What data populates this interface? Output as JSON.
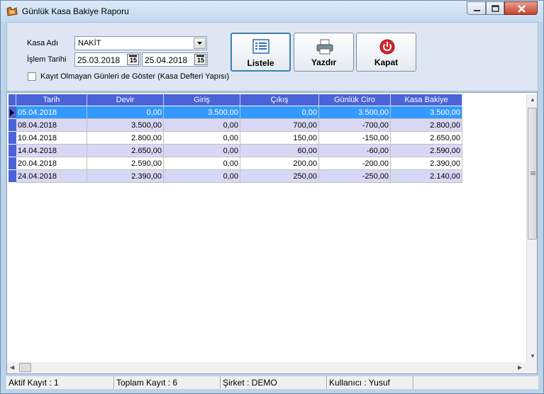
{
  "window": {
    "title": "Günlük Kasa Bakiye Raporu"
  },
  "filters": {
    "kasa_label": "Kasa Adı",
    "kasa_value": "NAKİT",
    "tarih_label": "İşlem Tarihi",
    "date_start": "25.03.2018",
    "date_end": "25.04.2018",
    "checkbox_label": "Kayıt Olmayan Günleri de Göster (Kasa Defteri Yapısı)"
  },
  "buttons": {
    "list": "Listele",
    "print": "Yazdır",
    "close": "Kapat"
  },
  "grid": {
    "columns": [
      "Tarih",
      "Devir",
      "Giriş",
      "Çıkış",
      "Günlük Ciro",
      "Kasa Bakiye"
    ],
    "rows": [
      [
        "05.04.2018",
        "0,00",
        "3.500,00",
        "0,00",
        "3.500,00",
        "3.500,00"
      ],
      [
        "08.04.2018",
        "3.500,00",
        "0,00",
        "700,00",
        "-700,00",
        "2.800,00"
      ],
      [
        "10.04.2018",
        "2.800,00",
        "0,00",
        "150,00",
        "-150,00",
        "2.650,00"
      ],
      [
        "14.04.2018",
        "2.650,00",
        "0,00",
        "60,00",
        "-60,00",
        "2.590,00"
      ],
      [
        "20.04.2018",
        "2.590,00",
        "0,00",
        "200,00",
        "-200,00",
        "2.390,00"
      ],
      [
        "24.04.2018",
        "2.390,00",
        "0,00",
        "250,00",
        "-250,00",
        "2.140,00"
      ]
    ]
  },
  "status": {
    "aktif": "Aktif Kayıt : 1",
    "toplam": "Toplam Kayıt : 6",
    "sirket": "Şirket : DEMO",
    "kullanici": "Kullanıcı : Yusuf"
  },
  "colors": {
    "header_blue": "#4a63d8",
    "selected": "#3399ff",
    "alt_row": "#d8d8f6"
  }
}
